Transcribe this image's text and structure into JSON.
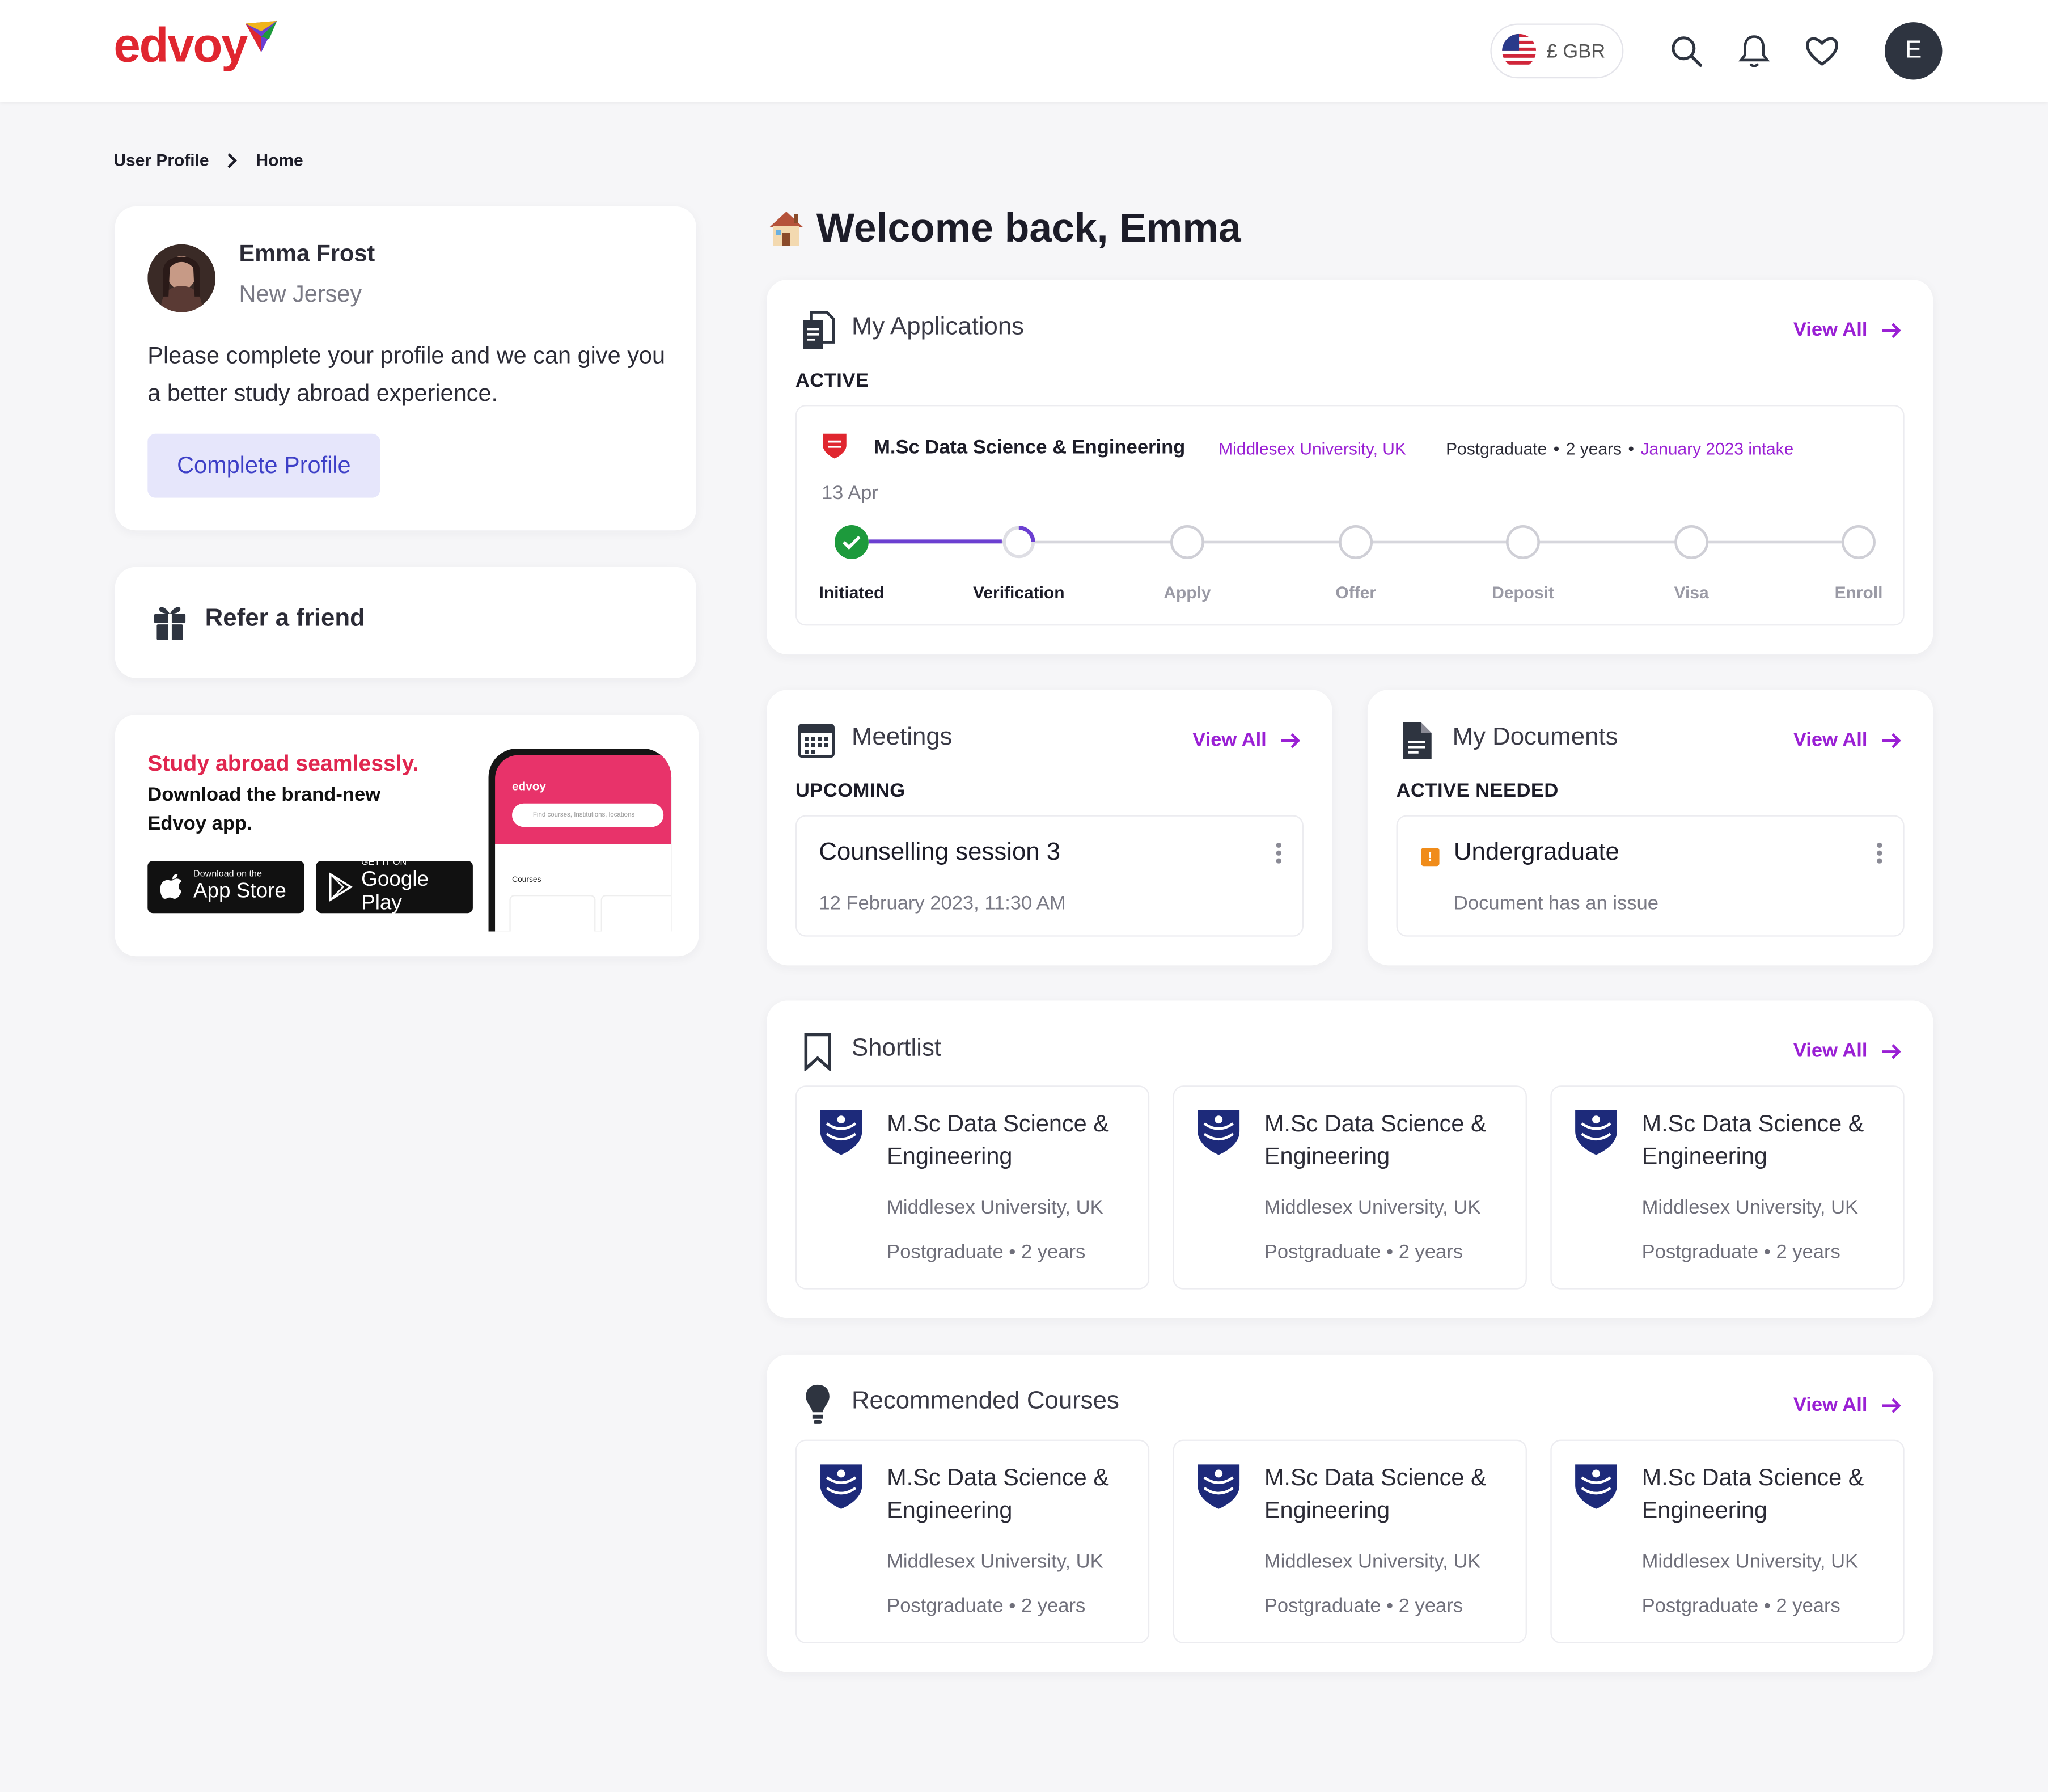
{
  "header": {
    "logo_text": "edvoy",
    "currency": "£ GBR"
  },
  "breadcrumb": [
    "User Profile",
    "Home"
  ],
  "profile": {
    "name": "Emma Frost",
    "location": "New Jersey",
    "prompt": "Please complete your profile and we can give you a better study abroad experience.",
    "button": "Complete Profile"
  },
  "refer": {
    "label": "Refer a friend"
  },
  "promo": {
    "headline": "Study abroad seamlessly.",
    "sub": "Download the brand-new Edvoy app.",
    "appstore_small": "Download on the",
    "appstore_big": "App Store",
    "gplay_small": "GET IT ON",
    "gplay_big": "Google Play",
    "phone_brand": "edvoy",
    "phone_search": "Find courses, Institutions, locations",
    "phone_courses": "Courses"
  },
  "welcome": "Welcome back, Emma",
  "applications": {
    "title": "My Applications",
    "view_all": "View All",
    "status": "ACTIVE",
    "course": "M.Sc Data Science & Engineering",
    "university": "Middlesex University, UK",
    "level": "Postgraduate",
    "duration": "2 years",
    "intake": "January 2023 intake",
    "date": "13 Apr",
    "steps": [
      "Initiated",
      "Verification",
      "Apply",
      "Offer",
      "Deposit",
      "Visa",
      "Enroll"
    ],
    "completed_steps": 1,
    "current_step": "Verification"
  },
  "meetings": {
    "title": "Meetings",
    "view_all": "View All",
    "status": "UPCOMING",
    "item_title": "Counselling session 3",
    "item_time": "12 February 2023, 11:30 AM"
  },
  "documents": {
    "title": "My Documents",
    "view_all": "View All",
    "status": "ACTIVE NEEDED",
    "item_title": "Undergraduate",
    "item_sub": "Document has an issue"
  },
  "shortlist": {
    "title": "Shortlist",
    "view_all": "View All",
    "items": [
      {
        "title": "M.Sc Data Science & Engineering",
        "university": "Middlesex University, UK",
        "meta": "Postgraduate • 2 years"
      },
      {
        "title": "M.Sc Data Science & Engineering",
        "university": "Middlesex University, UK",
        "meta": "Postgraduate • 2 years"
      },
      {
        "title": "M.Sc Data Science & Engineering",
        "university": "Middlesex University, UK",
        "meta": "Postgraduate • 2 years"
      }
    ]
  },
  "recommended": {
    "title": "Recommended Courses",
    "view_all": "View All",
    "items": [
      {
        "title": "M.Sc Data Science & Engineering",
        "university": "Middlesex University, UK",
        "meta": "Postgraduate • 2 years"
      },
      {
        "title": "M.Sc Data Science & Engineering",
        "university": "Middlesex University, UK",
        "meta": "Postgraduate • 2 years"
      },
      {
        "title": "M.Sc Data Science & Engineering",
        "university": "Middlesex University, UK",
        "meta": "Postgraduate • 2 years"
      }
    ]
  },
  "colors": {
    "brand": "#e0262f",
    "accent": "#9a20d4",
    "progress": "#6b3fd1",
    "success": "#1d9a3c",
    "warning": "#f08c1a",
    "crest": "#1d2a7a"
  }
}
